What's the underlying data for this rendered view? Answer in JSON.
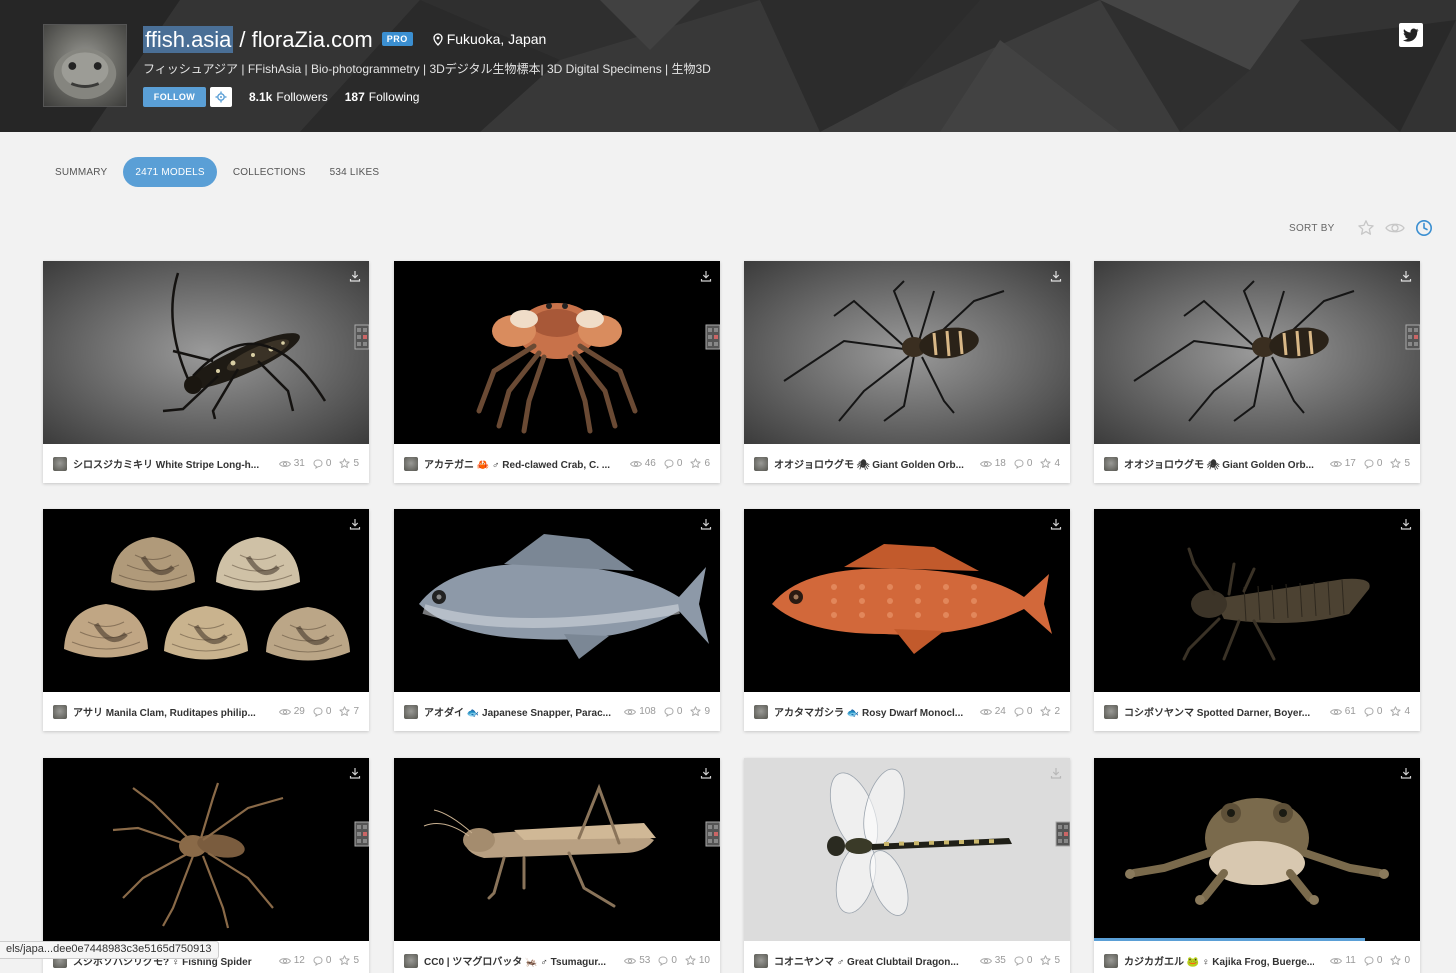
{
  "header": {
    "username_selected": "ffish.asia",
    "username_rest": "/ floraZia.com",
    "pro_badge": "PRO",
    "location": "Fukuoka, Japan",
    "bio": "フィッシュアジア | FFishAsia | Bio-photogrammetry | 3Dデジタル生物標本| 3D Digital Specimens | 生物3D",
    "follow_label": "FOLLOW",
    "followers_count": "8.1k",
    "followers_label": "Followers",
    "following_count": "187",
    "following_label": "Following"
  },
  "tabs": [
    {
      "label": "SUMMARY",
      "active": false
    },
    {
      "label": "2471 MODELS",
      "active": true
    },
    {
      "label": "COLLECTIONS",
      "active": false
    },
    {
      "label": "534 LIKES",
      "active": false
    }
  ],
  "sort": {
    "label": "SORT BY"
  },
  "models": [
    {
      "title": "シロスジカミキリ White Stripe Long-h...",
      "views": "31",
      "comments": "0",
      "likes": "5",
      "subject": "beetle",
      "bg": "grey"
    },
    {
      "title": "アカテガニ 🦀 ♂ Red-clawed Crab, C. ...",
      "views": "46",
      "comments": "0",
      "likes": "6",
      "subject": "crab",
      "bg": "black"
    },
    {
      "title": "オオジョロウグモ 🕷 Giant Golden Orb...",
      "views": "18",
      "comments": "0",
      "likes": "4",
      "subject": "spider",
      "bg": "grey"
    },
    {
      "title": "オオジョロウグモ 🕷 Giant Golden Orb...",
      "views": "17",
      "comments": "0",
      "likes": "5",
      "subject": "spider",
      "bg": "grey"
    },
    {
      "title": "アサリ Manila Clam, Ruditapes philip...",
      "views": "29",
      "comments": "0",
      "likes": "7",
      "subject": "clams",
      "bg": "black"
    },
    {
      "title": "アオダイ 🐟 Japanese Snapper, Parac...",
      "views": "108",
      "comments": "0",
      "likes": "9",
      "subject": "bluefish",
      "bg": "black"
    },
    {
      "title": "アカタマガシラ 🐟 Rosy Dwarf Monocl...",
      "views": "24",
      "comments": "0",
      "likes": "2",
      "subject": "redfish",
      "bg": "black"
    },
    {
      "title": "コシボソヤンマ Spotted Darner, Boyer...",
      "views": "61",
      "comments": "0",
      "likes": "4",
      "subject": "nymph",
      "bg": "black"
    },
    {
      "title": "スジボソハシリグモ? ♀ Fishing Spider",
      "views": "12",
      "comments": "0",
      "likes": "5",
      "subject": "huntsman",
      "bg": "black"
    },
    {
      "title": "CC0 | ツマグロバッタ 🦗 ♂ Tsumagur...",
      "views": "53",
      "comments": "0",
      "likes": "10",
      "subject": "grasshopper",
      "bg": "black"
    },
    {
      "title": "コオニヤンマ ♂ Great Clubtail Dragon...",
      "views": "35",
      "comments": "0",
      "likes": "5",
      "subject": "dragonfly",
      "bg": "light"
    },
    {
      "title": "カジカガエル 🐸 ♀ Kajika Frog, Buerge...",
      "views": "11",
      "comments": "0",
      "likes": "0",
      "subject": "frog",
      "bg": "black",
      "loading": 0.83
    }
  ],
  "status_bar": {
    "url": "els/japa...dee0e7448983c3e5165d750913"
  },
  "colors": {
    "accent": "#5a9fd6",
    "pro": "#3b8fd1",
    "header_bg": "#2e2e2e"
  }
}
